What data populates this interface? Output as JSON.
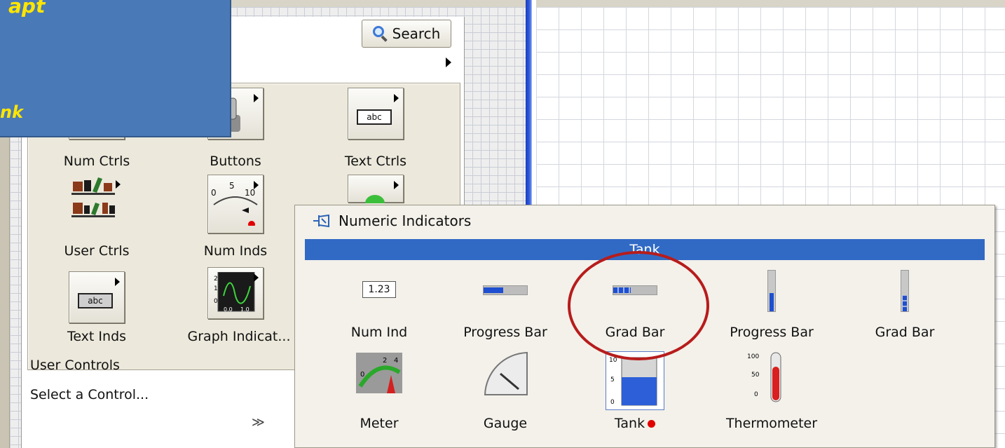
{
  "overlay": {
    "line1": "apt",
    "line2": "nk"
  },
  "palette": {
    "search_label": "Search",
    "categories": [
      {
        "label": "Num Ctrls"
      },
      {
        "label": "Buttons"
      },
      {
        "label": "Text Ctrls",
        "icon_text": "abc"
      },
      {
        "label": "User Ctrls"
      },
      {
        "label": "Num Inds"
      },
      {
        "label": "Text Inds",
        "icon_text": "abc"
      },
      {
        "label": "Graph Indicat..."
      }
    ],
    "num_inds_ticks": [
      "0",
      "5",
      "10"
    ],
    "graph_ticks": [
      "2",
      "1",
      "0",
      "0.0",
      "1.0"
    ],
    "user_controls": "User Controls",
    "select_control": "Select a Control...",
    "expand_glyph": "≫"
  },
  "numeric_indicators": {
    "title": "Numeric Indicators",
    "hover_label": "Tank",
    "items": [
      {
        "label": "Num Ind",
        "value": "1.23"
      },
      {
        "label": "Progress Bar",
        "fill_fraction": 0.45
      },
      {
        "label": "Grad Bar",
        "fill_fraction": 0.4
      },
      {
        "label": "Progress Bar",
        "fill_fraction": 0.45
      },
      {
        "label": "Grad Bar",
        "fill_fraction": 0.4
      },
      {
        "label": "Meter"
      },
      {
        "label": "Gauge"
      },
      {
        "label": "Tank"
      },
      {
        "label": "Thermometer"
      }
    ],
    "tank_ticks": [
      "10",
      "5",
      "0"
    ],
    "thermo_ticks": [
      "100",
      "50",
      "0"
    ],
    "meter_ticks": [
      "0",
      "2",
      "4"
    ]
  },
  "colors": {
    "overlay_bg": "#4a79b7",
    "overlay_text": "#ffe600",
    "highlight": "#316ac5",
    "selection_circle": "#b71c1c",
    "bar_fill": "#1e4fd0"
  }
}
